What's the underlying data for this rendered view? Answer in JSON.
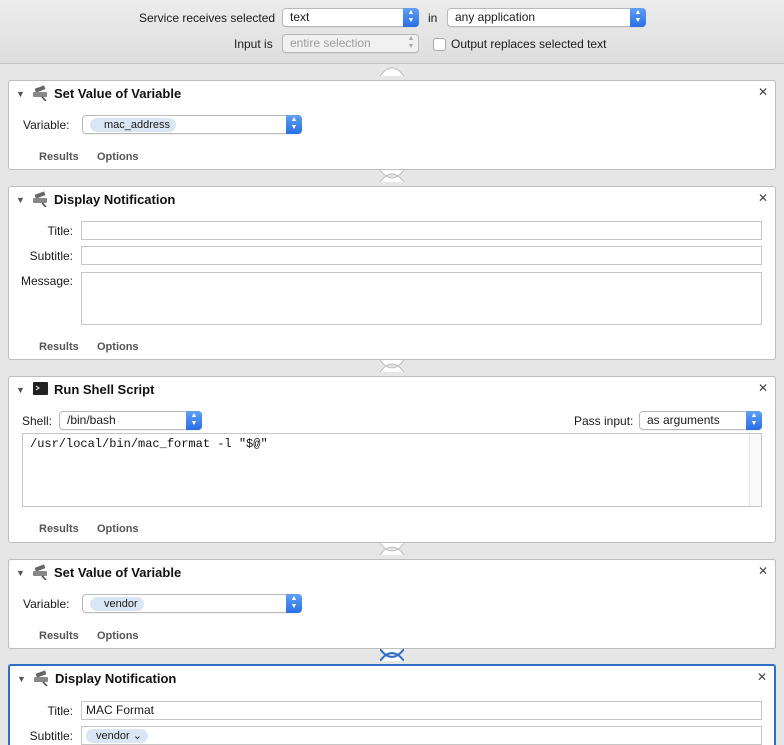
{
  "header": {
    "service_label": "Service receives selected",
    "service_value": "text",
    "in_label": "in",
    "app_value": "any application",
    "input_is_label": "Input is",
    "input_is_value": "entire selection",
    "output_replaces_label": "Output replaces selected text"
  },
  "actions": [
    {
      "title": "Set Value of Variable",
      "variable_label": "Variable:",
      "variable_value": "mac_address",
      "results": "Results",
      "options": "Options"
    },
    {
      "title": "Display Notification",
      "title_label": "Title:",
      "title_value": "",
      "subtitle_label": "Subtitle:",
      "subtitle_value": "",
      "message_label": "Message:",
      "message_value": "",
      "results": "Results",
      "options": "Options"
    },
    {
      "title": "Run Shell Script",
      "shell_label": "Shell:",
      "shell_value": "/bin/bash",
      "pass_input_label": "Pass input:",
      "pass_input_value": "as arguments",
      "script": "/usr/local/bin/mac_format -l \"$@\"",
      "results": "Results",
      "options": "Options"
    },
    {
      "title": "Set Value of Variable",
      "variable_label": "Variable:",
      "variable_value": "vendor",
      "results": "Results",
      "options": "Options"
    },
    {
      "title": "Display Notification",
      "title_label": "Title:",
      "title_value": "MAC Format",
      "subtitle_label": "Subtitle:",
      "subtitle_token": "vendor"
    }
  ],
  "icons": {
    "close": "close-icon",
    "disclosure": "disclosure-triangle-icon",
    "variable_action": "variable-action-icon",
    "terminal": "terminal-icon"
  },
  "colors": {
    "accent": "#2d6fc7",
    "popup_arrow": "#2a6fe4",
    "token_bg": "#dbe6f4"
  }
}
